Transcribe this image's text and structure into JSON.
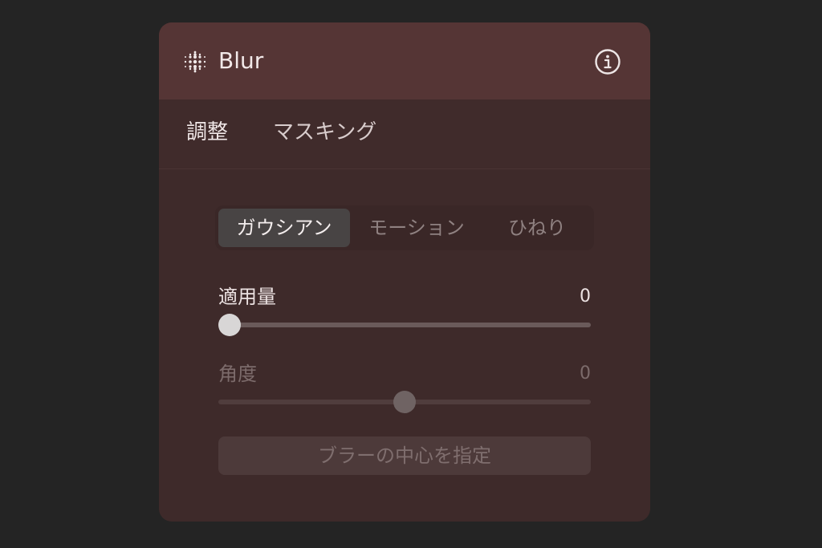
{
  "header": {
    "title": "Blur",
    "left_icon": "blur-dots-icon",
    "right_icon": "info-icon"
  },
  "tabs": [
    {
      "label": "調整",
      "active": true
    },
    {
      "label": "マスキング",
      "active": false
    }
  ],
  "blur_types": {
    "options": [
      "ガウシアン",
      "モーション",
      "ひねり"
    ],
    "selected": "ガウシアン"
  },
  "amount": {
    "label": "適用量",
    "value": "0",
    "fraction": 0
  },
  "angle": {
    "label": "角度",
    "value": "0",
    "fraction": 0.5,
    "disabled": true
  },
  "center_button": {
    "label": "ブラーの中心を指定",
    "disabled": true
  },
  "colors": {
    "background": "#242424",
    "panel": "#3e2a2a",
    "header": "#553535",
    "selected_segment": "#484444"
  }
}
